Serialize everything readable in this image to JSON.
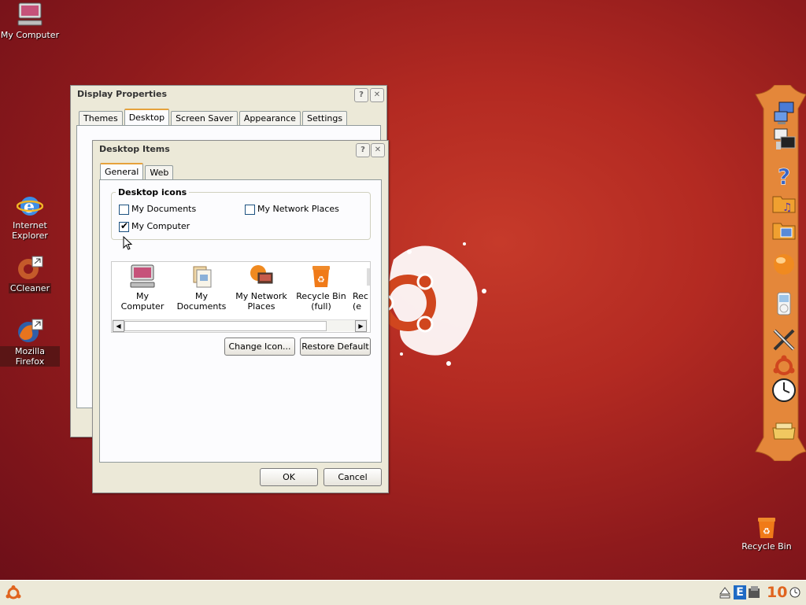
{
  "desktop": {
    "icons": [
      {
        "label": "My Computer",
        "icon": "computer-icon"
      },
      {
        "label": "Internet Explorer",
        "icon": "internet-explorer-icon"
      },
      {
        "label": "CCleaner",
        "icon": "ccleaner-icon"
      },
      {
        "label": "Mozilla Firefox",
        "icon": "firefox-icon"
      },
      {
        "label": "Recycle Bin",
        "icon": "recycle-bin-icon"
      }
    ],
    "ie_line1": "Internet",
    "ie_line2": "Explorer"
  },
  "display_properties": {
    "title": "Display Properties",
    "help_btn": "?",
    "close_btn": "✕",
    "tabs": [
      "Themes",
      "Desktop",
      "Screen Saver",
      "Appearance",
      "Settings"
    ],
    "active_tab": "Desktop"
  },
  "desktop_items": {
    "title": "Desktop Items",
    "help_btn": "?",
    "close_btn": "✕",
    "tabs": [
      "General",
      "Web"
    ],
    "active_tab": "General",
    "group_title": "Desktop icons",
    "checkboxes": [
      {
        "label": "My Documents",
        "checked": false
      },
      {
        "label": "My Network Places",
        "checked": false
      },
      {
        "label": "My Computer",
        "checked": true
      }
    ],
    "icon_list": [
      {
        "line1": "My Computer",
        "line2": ""
      },
      {
        "line1": "My Documents",
        "line2": ""
      },
      {
        "line1": "My Network",
        "line2": "Places"
      },
      {
        "line1": "Recycle Bin",
        "line2": "(full)"
      },
      {
        "line1": "Rec",
        "line2": "(e"
      }
    ],
    "change_icon_btn": "Change Icon...",
    "restore_default_btn": "Restore Default",
    "ok_btn": "OK",
    "cancel_btn": "Cancel"
  },
  "taskbar": {
    "clock": "10"
  },
  "colors": {
    "accent": "#e6a23c",
    "desktop_bg": "#b32a22",
    "dock": "#e4873a"
  }
}
